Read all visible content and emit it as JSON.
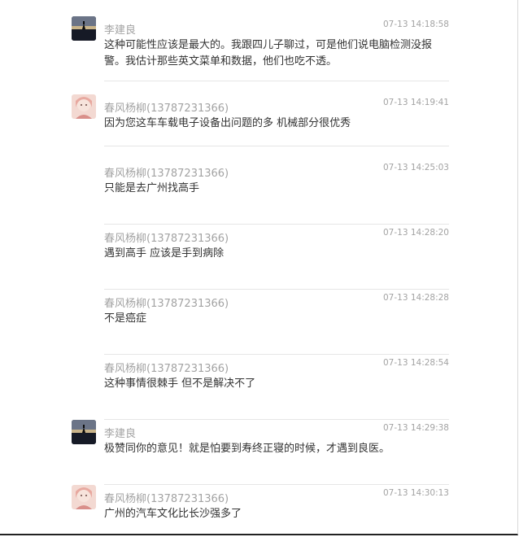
{
  "messages": [
    {
      "avatar": "lake-sunset-avatar",
      "name": "李建良",
      "time": "07-13 14:18:58",
      "text": "这种可能性应该是最大的。我跟四儿子聊过，可是他们说电脑检测没报警。我估计那些英文菜单和数据，他们也吃不透。"
    },
    {
      "avatar": "girl-portrait-avatar",
      "name": "春风杨柳(13787231366)",
      "time": "07-13 14:19:41",
      "text": "因为您这车车载电子设备出问题的多  机械部分很优秀"
    },
    {
      "avatar": null,
      "name": "春风杨柳(13787231366)",
      "time": "07-13 14:25:03",
      "text": "只能是去广州找高手"
    },
    {
      "avatar": null,
      "name": "春风杨柳(13787231366)",
      "time": "07-13 14:28:20",
      "text": "遇到高手 应该是手到病除"
    },
    {
      "avatar": null,
      "name": "春风杨柳(13787231366)",
      "time": "07-13 14:28:28",
      "text": "不是癌症"
    },
    {
      "avatar": null,
      "name": "春风杨柳(13787231366)",
      "time": "07-13 14:28:54",
      "text": "这种事情很棘手 但不是解决不了"
    },
    {
      "avatar": "lake-sunset-avatar",
      "name": "李建良",
      "time": "07-13 14:29:38",
      "text": "极赞同你的意见！就是怕要到寿终正寝的时候，才遇到良医。"
    },
    {
      "avatar": "girl-portrait-avatar",
      "name": "春风杨柳(13787231366)",
      "time": "07-13 14:30:13",
      "text": "广州的汽车文化比长沙强多了"
    }
  ]
}
